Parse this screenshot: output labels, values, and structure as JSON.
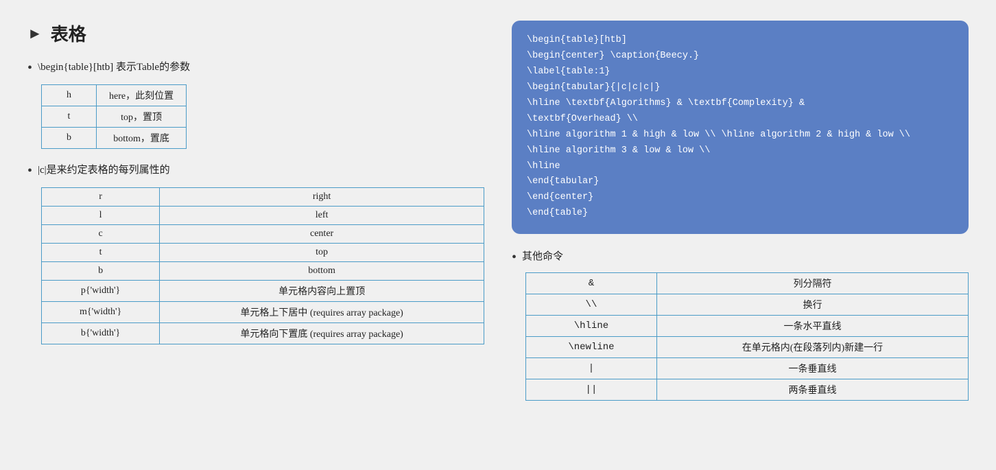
{
  "title": "表格",
  "left": {
    "bullet1": {
      "text": "\\begin{table}[htb] 表示Table的参数",
      "table": [
        [
          "h",
          "here，此刻位置"
        ],
        [
          "t",
          "top，置顶"
        ],
        [
          "b",
          "bottom，置底"
        ]
      ]
    },
    "bullet2": {
      "text": "|c|是来约定表格的每列属性的",
      "table": [
        [
          "r",
          "right"
        ],
        [
          "l",
          "left"
        ],
        [
          "c",
          "center"
        ],
        [
          "t",
          "top"
        ],
        [
          "b",
          "bottom"
        ],
        [
          "p{'width'}",
          "单元格内容向上置顶"
        ],
        [
          "m{'width'}",
          "单元格上下居中 (requires array package)"
        ],
        [
          "b{'width'}",
          "单元格向下置底 (requires array package)"
        ]
      ]
    }
  },
  "right": {
    "code": [
      "\\begin{table}[htb]",
      "\\begin{center} \\caption{Beecy.}",
      "\\label{table:1}",
      "\\begin{tabular}{|c|c|c|}",
      "\\hline  \\textbf{Algorithms} & \\textbf{Complexity} &",
      "\\textbf{Overhead} \\\\",
      "\\hline algorithm 1 & high & low \\\\ \\hline algorithm 2 & high & low \\\\",
      "\\hline algorithm 3 & low & low \\\\",
      "\\hline",
      "\\end{tabular}",
      "\\end{center}",
      "\\end{table}"
    ],
    "other_commands_label": "其他命令",
    "commands_table": [
      [
        "&",
        "列分隔符"
      ],
      [
        "\\\\",
        "换行"
      ],
      [
        "\\hline",
        "一条水平直线"
      ],
      [
        "\\newline",
        "在单元格内(在段落列内)新建一行"
      ],
      [
        "|",
        "一条垂直线"
      ],
      [
        "||",
        "两条垂直线"
      ]
    ]
  }
}
